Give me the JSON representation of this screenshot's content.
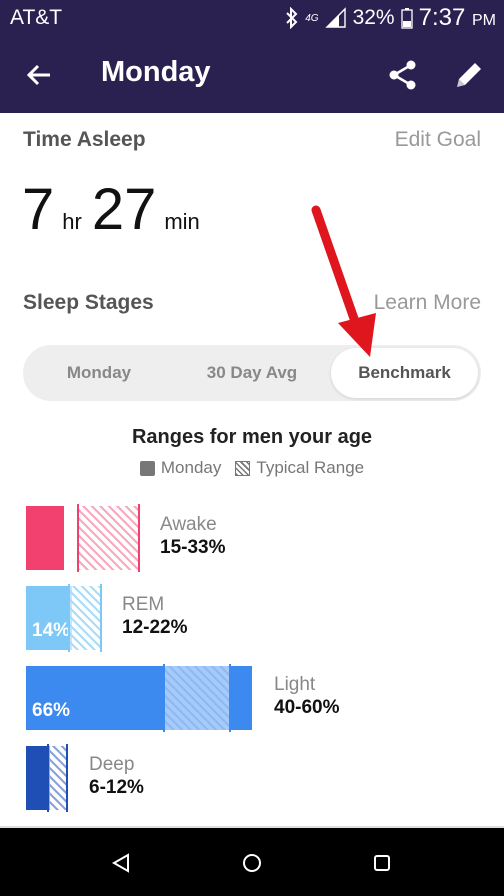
{
  "status_bar": {
    "carrier": "AT&T",
    "battery": "32%",
    "time": "7:37",
    "time_suffix": "PM",
    "network_badge": "4G",
    "icons": [
      "bluetooth-icon",
      "signal-icon",
      "battery-icon"
    ]
  },
  "app_bar": {
    "title": "Monday",
    "icons": [
      "back-arrow-icon",
      "share-icon",
      "edit-pencil-icon"
    ]
  },
  "time_asleep": {
    "heading": "Time Asleep",
    "link": "Edit Goal",
    "hours": "7",
    "hours_unit": "hr",
    "minutes": "27",
    "minutes_unit": "min"
  },
  "sleep_stages": {
    "heading": "Sleep Stages",
    "link": "Learn More",
    "tabs": [
      {
        "label": "Monday",
        "selected": false
      },
      {
        "label": "30 Day Avg",
        "selected": false
      },
      {
        "label": "Benchmark",
        "selected": true
      }
    ]
  },
  "benchmark": {
    "title": "Ranges for men your age",
    "legend": {
      "solid": "Monday",
      "hatched": "Typical Range"
    },
    "stages": [
      {
        "name": "Awake",
        "range": "15-33%",
        "value_label": "",
        "color": "#f2416e",
        "hatch_color": "#f7a9bd"
      },
      {
        "name": "REM",
        "range": "12-22%",
        "value_label": "14%",
        "color": "#7ec8f7",
        "hatch_color": "#a9dcf9"
      },
      {
        "name": "Light",
        "range": "40-60%",
        "value_label": "66%",
        "color": "#3c89f0",
        "hatch_color": "#8bbaf6"
      },
      {
        "name": "Deep",
        "range": "6-12%",
        "value_label": "",
        "color": "#1f4eb4",
        "hatch_color": "#8aa3db"
      }
    ]
  },
  "colors": {
    "header_bg": "#2a2150",
    "annotation_arrow": "#e0161e"
  },
  "nav_bar": {
    "icons": [
      "back-triangle-icon",
      "home-circle-icon",
      "recents-square-icon"
    ]
  }
}
